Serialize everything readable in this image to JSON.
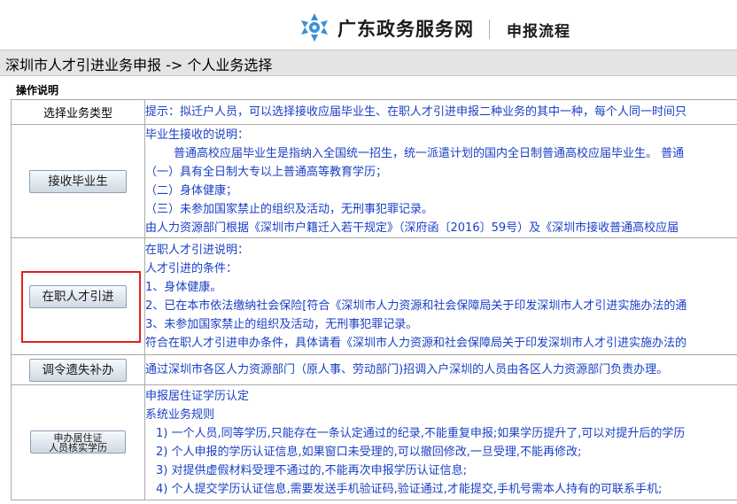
{
  "header": {
    "logo_text": "广东政务服务网",
    "subtitle": "申报流程",
    "colors": {
      "logo_blue": "#3a8fd6",
      "title": "#1a1a1a"
    }
  },
  "breadcrumb": "深圳市人才引进业务申报 -> 个人业务选择",
  "section_title": "操作说明",
  "table": {
    "header_left": "选择业务类型",
    "header_right": "提示：拟迁户人员，可以选择接收应届毕业生、在职人才引进申报二种业务的其中一种，每个人同一时间只",
    "rows": [
      {
        "button": "接收毕业生",
        "lines": [
          "毕业生接收的说明：",
          "普通高校应届毕业生是指纳入全国统一招生，统一派遣计划的国内全日制普通高校应届毕业生。 普通",
          "（一）具有全日制大专以上普通高等教育学历；",
          "（二）身体健康；",
          "（三）未参加国家禁止的组织及活动，无刑事犯罪记录。",
          "由人力资源部门根据《深圳市户籍迁入若干规定》（深府函〔2016〕59号）及《深圳市接收普通高校应届"
        ]
      },
      {
        "button": "在职人才引进",
        "lines": [
          "在职人才引进说明：",
          "人才引进的条件：",
          "1、身体健康。",
          "2、已在本市依法缴纳社会保险[符合《深圳市人力资源和社会保障局关于印发深圳市人才引进实施办法的通",
          "3、未参加国家禁止的组织及活动，无刑事犯罪记录。",
          "符合在职人才引进申办条件，具体请看《深圳市人力资源和社会保障局关于印发深圳市人才引进实施办法的"
        ]
      },
      {
        "button": "调令遗失补办",
        "lines": [
          "通过深圳市各区人力资源部门（原人事、劳动部门)招调入户深圳的人员由各区人力资源部门负责办理。"
        ]
      },
      {
        "button_line1": "申办居住证",
        "button_line2": "人员核实学历",
        "lines": [
          "申报居住证学历认定",
          "系统业务规则",
          "1) 一个人员,同等学历,只能存在一条认定通过的纪录,不能重复申报;如果学历提升了,可以对提升后的学历",
          "2) 个人申报的学历认证信息,如果窗口未受理的,可以撤回修改,一旦受理,不能再修改;",
          "3) 对提供虚假材料受理不通过的,不能再次申报学历认证信息;",
          "4) 个人提交学历认证信息,需要发送手机验证码,验证通过,才能提交,手机号需本人持有的可联系手机;"
        ]
      }
    ]
  },
  "colors": {
    "text_blue": "#1a3fc4",
    "highlight_red": "#e02020",
    "bar_gray": "#e4e4e4"
  }
}
